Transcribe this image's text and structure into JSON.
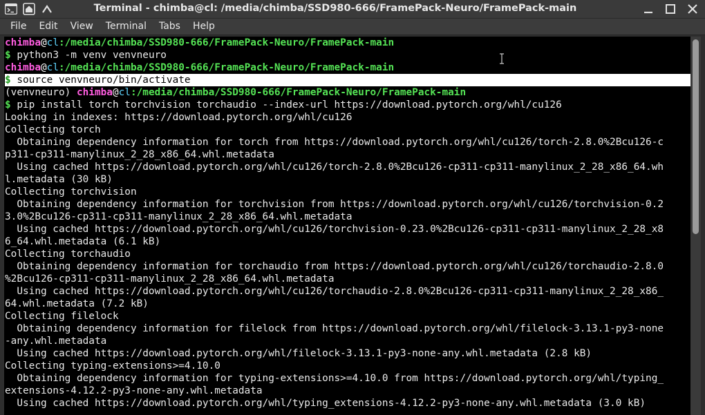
{
  "window": {
    "title": "Terminal - chimba@cl: /media/chimba/SSD980-666/FramePack-Neuro/FramePack-main"
  },
  "menu": [
    "File",
    "Edit",
    "View",
    "Terminal",
    "Tabs",
    "Help"
  ],
  "prompt": {
    "user": "chimba",
    "at": "@",
    "host": "cl",
    "path": ":/media/chimba/SSD980-666/FramePack-Neuro/FramePack-main",
    "symbol": "$",
    "venv": "(venvneuro) "
  },
  "lines": [
    {
      "kind": "prompt"
    },
    {
      "kind": "cmd",
      "text": " python3 -m venv venvneuro"
    },
    {
      "kind": "prompt"
    },
    {
      "kind": "cmd-hl",
      "text": " source venvneuro/bin/activate"
    },
    {
      "kind": "venv-prompt"
    },
    {
      "kind": "cmd",
      "text": " pip install torch torchvision torchaudio --index-url https://download.pytorch.org/whl/cu126"
    },
    {
      "kind": "out",
      "text": "Looking in indexes: https://download.pytorch.org/whl/cu126"
    },
    {
      "kind": "out",
      "text": "Collecting torch"
    },
    {
      "kind": "out",
      "text": "  Obtaining dependency information for torch from https://download.pytorch.org/whl/cu126/torch-2.8.0%2Bcu126-c"
    },
    {
      "kind": "out",
      "text": "p311-cp311-manylinux_2_28_x86_64.whl.metadata"
    },
    {
      "kind": "out",
      "text": "  Using cached https://download.pytorch.org/whl/cu126/torch-2.8.0%2Bcu126-cp311-cp311-manylinux_2_28_x86_64.wh"
    },
    {
      "kind": "out",
      "text": "l.metadata (30 kB)"
    },
    {
      "kind": "out",
      "text": "Collecting torchvision"
    },
    {
      "kind": "out",
      "text": "  Obtaining dependency information for torchvision from https://download.pytorch.org/whl/cu126/torchvision-0.2"
    },
    {
      "kind": "out",
      "text": "3.0%2Bcu126-cp311-cp311-manylinux_2_28_x86_64.whl.metadata"
    },
    {
      "kind": "out",
      "text": "  Using cached https://download.pytorch.org/whl/cu126/torchvision-0.23.0%2Bcu126-cp311-cp311-manylinux_2_28_x8"
    },
    {
      "kind": "out",
      "text": "6_64.whl.metadata (6.1 kB)"
    },
    {
      "kind": "out",
      "text": "Collecting torchaudio"
    },
    {
      "kind": "out",
      "text": "  Obtaining dependency information for torchaudio from https://download.pytorch.org/whl/cu126/torchaudio-2.8.0"
    },
    {
      "kind": "out",
      "text": "%2Bcu126-cp311-cp311-manylinux_2_28_x86_64.whl.metadata"
    },
    {
      "kind": "out",
      "text": "  Using cached https://download.pytorch.org/whl/cu126/torchaudio-2.8.0%2Bcu126-cp311-cp311-manylinux_2_28_x86_"
    },
    {
      "kind": "out",
      "text": "64.whl.metadata (7.2 kB)"
    },
    {
      "kind": "out",
      "text": "Collecting filelock"
    },
    {
      "kind": "out",
      "text": "  Obtaining dependency information for filelock from https://download.pytorch.org/whl/filelock-3.13.1-py3-none"
    },
    {
      "kind": "out",
      "text": "-any.whl.metadata"
    },
    {
      "kind": "out",
      "text": "  Using cached https://download.pytorch.org/whl/filelock-3.13.1-py3-none-any.whl.metadata (2.8 kB)"
    },
    {
      "kind": "out",
      "text": "Collecting typing-extensions>=4.10.0"
    },
    {
      "kind": "out",
      "text": "  Obtaining dependency information for typing-extensions>=4.10.0 from https://download.pytorch.org/whl/typing_"
    },
    {
      "kind": "out",
      "text": "extensions-4.12.2-py3-none-any.whl.metadata"
    },
    {
      "kind": "out",
      "text": "  Using cached https://download.pytorch.org/whl/typing_extensions-4.12.2-py3-none-any.whl.metadata (3.0 kB)"
    }
  ],
  "colors": {
    "user": "#ff5de0",
    "host": "#5fd6ff",
    "path": "#55e355",
    "background": "#000000",
    "text": "#eaeaea"
  },
  "icons": [
    "terminal-icon",
    "window-menu-icon",
    "keep-above-icon",
    "minimize-icon",
    "maximize-icon",
    "close-icon"
  ]
}
